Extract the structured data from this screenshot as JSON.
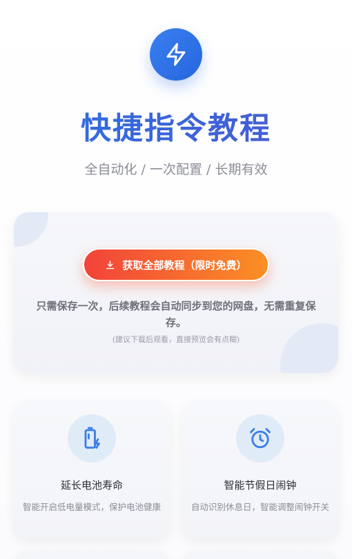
{
  "hero": {
    "icon": "lightning-bolt-icon",
    "title": "快捷指令教程",
    "subtitle": "全自动化 / 一次配置 / 长期有效"
  },
  "main_card": {
    "cta_icon": "download-icon",
    "cta_label": "获取全部教程（限时免费）",
    "description": "只需保存一次，后续教程会自动同步到您的网盘，无需重复保存。",
    "note": "(建议下载后观看，直接预览会有点糊)"
  },
  "features": [
    {
      "icon": "battery-charging-icon",
      "title": "延长电池寿命",
      "description": "智能开启低电量模式，保护电池健康"
    },
    {
      "icon": "alarm-clock-icon",
      "title": "智能节假日闹钟",
      "description": "自动识别休息日，智能调整闹钟开关"
    }
  ],
  "colors": {
    "accent_blue": "#2f6fe6",
    "title_gradient_start": "#2d6fe3",
    "title_gradient_end": "#4a5ad0",
    "cta_gradient_start": "#f2433a",
    "cta_gradient_end": "#fb8f25",
    "feature_icon_bg": "#e0ebf8"
  }
}
